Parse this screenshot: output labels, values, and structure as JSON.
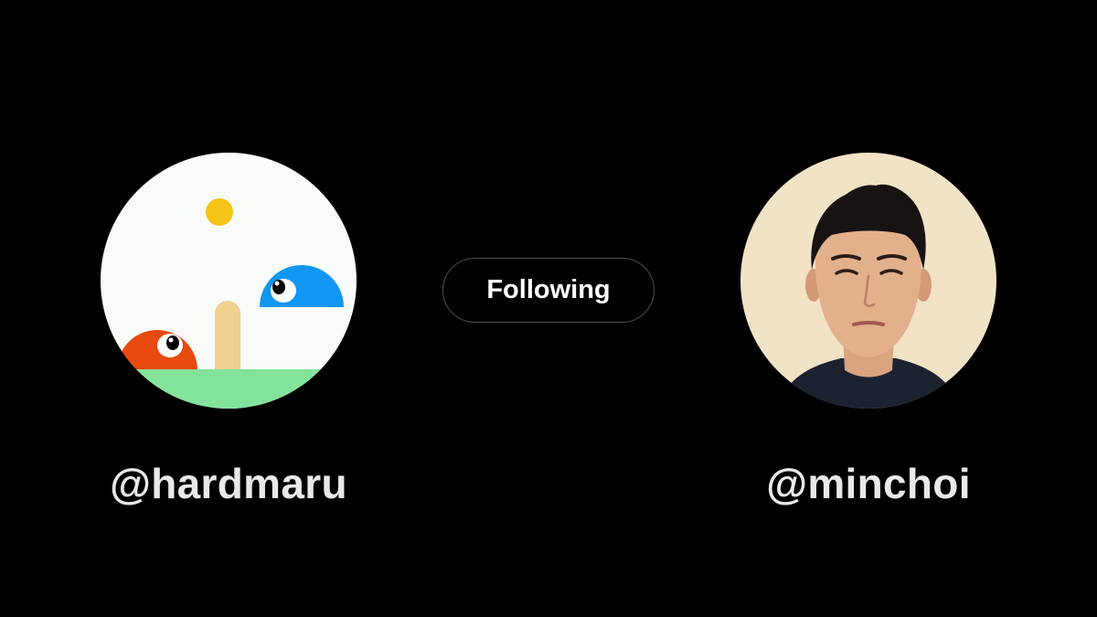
{
  "follow_button": {
    "label": "Following"
  },
  "left_user": {
    "handle": "@hardmaru",
    "avatar_icon": "cartoon-landscape-avatar-icon"
  },
  "right_user": {
    "handle": "@minchoi",
    "avatar_icon": "profile-photo-avatar-icon"
  },
  "colors": {
    "background": "#000000",
    "handle_text": "#e7e9ea",
    "button_border": "#4b4f54",
    "left_avatar_sky": "#f8fbf8",
    "left_avatar_grass": "#84e39b",
    "left_avatar_sun": "#f6c417",
    "left_avatar_red_blob": "#e84a10",
    "left_avatar_blue_blob": "#1296f3",
    "left_avatar_pillar": "#efd08f",
    "right_avatar_bg": "#f2e2c6"
  }
}
